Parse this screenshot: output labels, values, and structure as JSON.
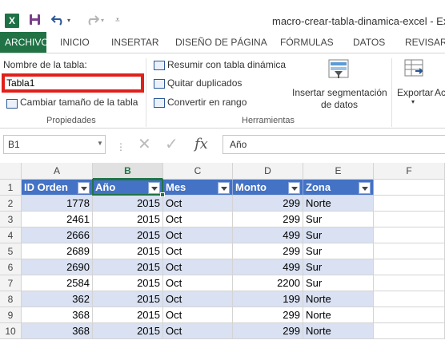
{
  "window": {
    "title": "macro-crear-tabla-dinamica-excel - Exce",
    "app_icon": "X"
  },
  "tabs": [
    "ARCHIVO",
    "INICIO",
    "INSERTAR",
    "DISEÑO DE PÁGINA",
    "FÓRMULAS",
    "DATOS",
    "REVISAR"
  ],
  "ribbon": {
    "propiedades": {
      "table_name_label": "Nombre de la tabla:",
      "table_name_value": "Tabla1",
      "resize_label": "Cambiar tamaño de la tabla",
      "group_label": "Propiedades"
    },
    "herramientas": {
      "pivot_label": "Resumir con tabla dinámica",
      "dedupe_label": "Quitar duplicados",
      "convert_label": "Convertir en rango",
      "slicer_line1": "Insertar segmentación",
      "slicer_line2": "de datos",
      "group_label": "Herramientas"
    },
    "export_label": "Exportar",
    "export_arrow": "▾",
    "next_label": "Ac"
  },
  "formula_bar": {
    "name_box": "B1",
    "formula": "Año",
    "fx_label": "fx"
  },
  "grid": {
    "columns": [
      "A",
      "B",
      "C",
      "D",
      "E",
      "F"
    ],
    "selected_column": "B",
    "row_numbers": [
      "1",
      "2",
      "3",
      "4",
      "5",
      "6",
      "7",
      "8",
      "9",
      "10"
    ],
    "headers": [
      "ID Orden",
      "Año",
      "Mes",
      "Monto",
      "Zona"
    ],
    "rows": [
      [
        "1778",
        "2015",
        "Oct",
        "299",
        "Norte"
      ],
      [
        "2461",
        "2015",
        "Oct",
        "299",
        "Sur"
      ],
      [
        "2666",
        "2015",
        "Oct",
        "499",
        "Sur"
      ],
      [
        "2689",
        "2015",
        "Oct",
        "299",
        "Sur"
      ],
      [
        "2690",
        "2015",
        "Oct",
        "499",
        "Sur"
      ],
      [
        "2584",
        "2015",
        "Oct",
        "2200",
        "Sur"
      ],
      [
        "362",
        "2015",
        "Oct",
        "199",
        "Norte"
      ],
      [
        "368",
        "2015",
        "Oct",
        "299",
        "Norte"
      ],
      [
        "368",
        "2015",
        "Oct",
        "299",
        "Norte"
      ]
    ]
  },
  "colors": {
    "accent": "#217346",
    "table_header": "#4472c4",
    "band": "#d9e1f2",
    "highlight_box": "#e0201b"
  }
}
